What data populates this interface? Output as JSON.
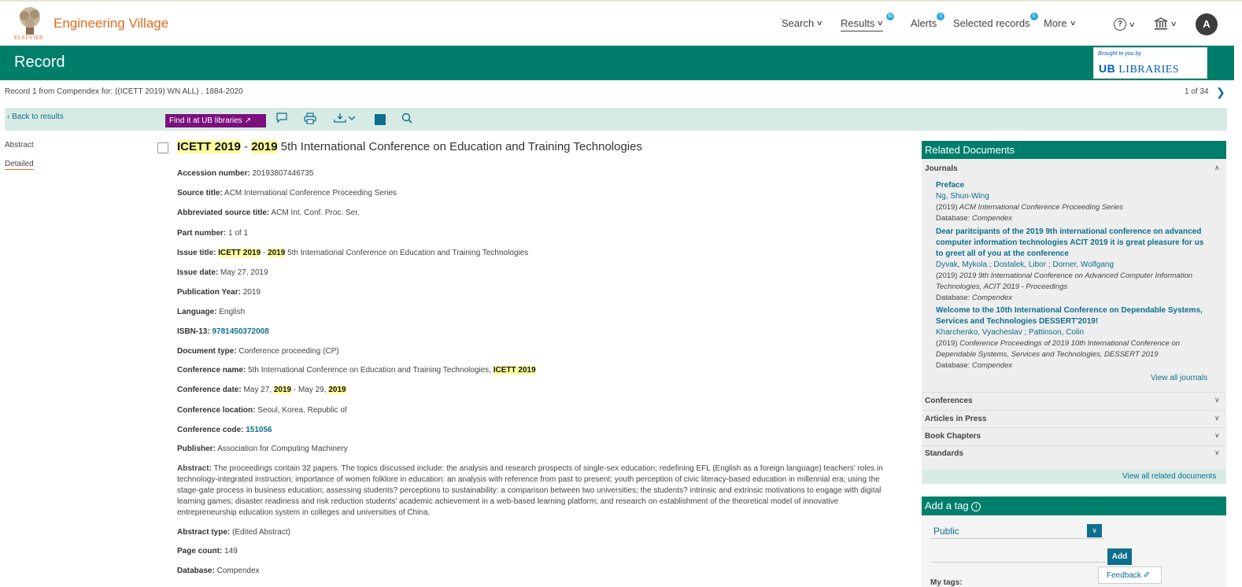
{
  "header": {
    "brand": "Engineering Village",
    "logo_text": "ELSEVIER",
    "nav": {
      "search": "Search",
      "results": "Results",
      "results_badge": "50",
      "alerts": "Alerts",
      "alerts_badge": "0",
      "selected_records": "Selected records",
      "selected_badge": "0",
      "more": "More"
    },
    "help_glyph": "?",
    "avatar_initial": "A"
  },
  "record_bar": {
    "title": "Record",
    "brought_by": "Brought to you by",
    "library_name": "LIBRARIES"
  },
  "record_info": "Record 1 from Compendex for: ((ICETT 2019) WN ALL) , 1884-2020",
  "pager": "1 of 34",
  "toolbar": {
    "back": "Back to results",
    "find_it": "Find it at UB libraries"
  },
  "sidenav": {
    "abstract": "Abstract",
    "detailed": "Detailed"
  },
  "record": {
    "title_hl1": "ICETT 2019",
    "title_sep": " - ",
    "title_hl2": "2019",
    "title_rest": " 5th International Conference on Education and Training Technologies",
    "fields": {
      "accession_label": "Accession number:",
      "accession": "20193807446735",
      "source_label": "Source title:",
      "source": "ACM International Conference Proceeding Series",
      "abbrev_label": "Abbreviated source title:",
      "abbrev": "ACM Int. Conf. Proc. Ser.",
      "part_label": "Part number:",
      "part": "1 of 1",
      "issue_title_label": "Issue title:",
      "issue_title_hl1": "ICETT 2019",
      "issue_title_sep": " - ",
      "issue_title_hl2": "2019",
      "issue_title_rest": " 5th International Conference on Education and Training Technologies",
      "issue_date_label": "Issue date:",
      "issue_date": "May 27, 2019",
      "pub_year_label": "Publication Year:",
      "pub_year": "2019",
      "language_label": "Language:",
      "language": "English",
      "isbn_label": "ISBN-13:",
      "isbn": "9781450372008",
      "doctype_label": "Document type:",
      "doctype": "Conference proceeding (CP)",
      "conf_name_label": "Conference name:",
      "conf_name": "5th International Conference on Education and Training Technologies, ",
      "conf_name_hl": "ICETT 2019",
      "conf_date_label": "Conference date:",
      "conf_date_a": "May 27, ",
      "conf_date_hl1": "2019",
      "conf_date_b": " - May 29, ",
      "conf_date_hl2": "2019",
      "conf_loc_label": "Conference location:",
      "conf_loc": "Seoul, Korea, Republic of",
      "conf_code_label": "Conference code:",
      "conf_code": "151056",
      "publisher_label": "Publisher:",
      "publisher": "Association for Computing Machinery",
      "abstract_label": "Abstract:",
      "abstract": "The proceedings contain 32 papers. The topics discussed include: the analysis and research prospects of single-sex education; redefining EFL (English as a foreign language) teachers' roles in technology-integrated instruction; importance of women folklore in education: an analysis with reference from past to present; youth perception of civic literacy-based education in millennial era; using the stage-gate process in business education; assessing students? perceptions to sustainability: a comparison between two universities; the students? intrinsic and extrinsic motivations to engage with digital learning games; disaster readiness and risk reduction students' academic achievement in a web-based learning platform; and research on establishment of the theoretical model of innovative entrepreneurship education system in colleges and universities of China.",
      "abstract_type_label": "Abstract type:",
      "abstract_type": "(Edited Abstract)",
      "page_count_label": "Page count:",
      "page_count": "149",
      "database_label": "Database:",
      "database": "Compendex"
    }
  },
  "related": {
    "heading": "Related Documents",
    "journals_label": "Journals",
    "items": [
      {
        "title": "Preface",
        "authors": "Ng, Shun-Wing",
        "year": "(2019)",
        "source": "ACM International Conference Proceeding Series",
        "db_label": "Database:",
        "db": "Compendex"
      },
      {
        "title": "Dear paritcipants of the 2019 9th international conference on advanced computer information technologies ACIT 2019 it is great pleasure for us to greet all of you at the conference",
        "authors": "Dyvak, Mykola ; Dostalek, Libor ; Dorner, Wolfgang",
        "year": "(2019)",
        "source": "2019 9th International Conference on Advanced Computer Information Technologies, ACIT 2019 - Proceedings",
        "db_label": "Database:",
        "db": "Compendex"
      },
      {
        "title": "Welcome to the 10th International Conference on Dependable Systems, Services and Technologies DESSERT'2019!",
        "authors": "Kharchenko, Vyacheslav ; Pattinson, Colin",
        "year": "(2019)",
        "source": "Conference Proceedings of 2019 10th International Conference on Dependable Systems, Services and Technologies, DESSERT 2019",
        "db_label": "Database:",
        "db": "Compendex"
      }
    ],
    "view_all_journals": "View all journals",
    "conferences": "Conferences",
    "articles_in_press": "Articles in Press",
    "book_chapters": "Book Chapters",
    "standards": "Standards",
    "view_all": "View all related documents"
  },
  "tag": {
    "heading": "Add a tag",
    "visibility": "Public",
    "add": "Add",
    "my_tags": "My tags:"
  },
  "feedback": "Feedback"
}
